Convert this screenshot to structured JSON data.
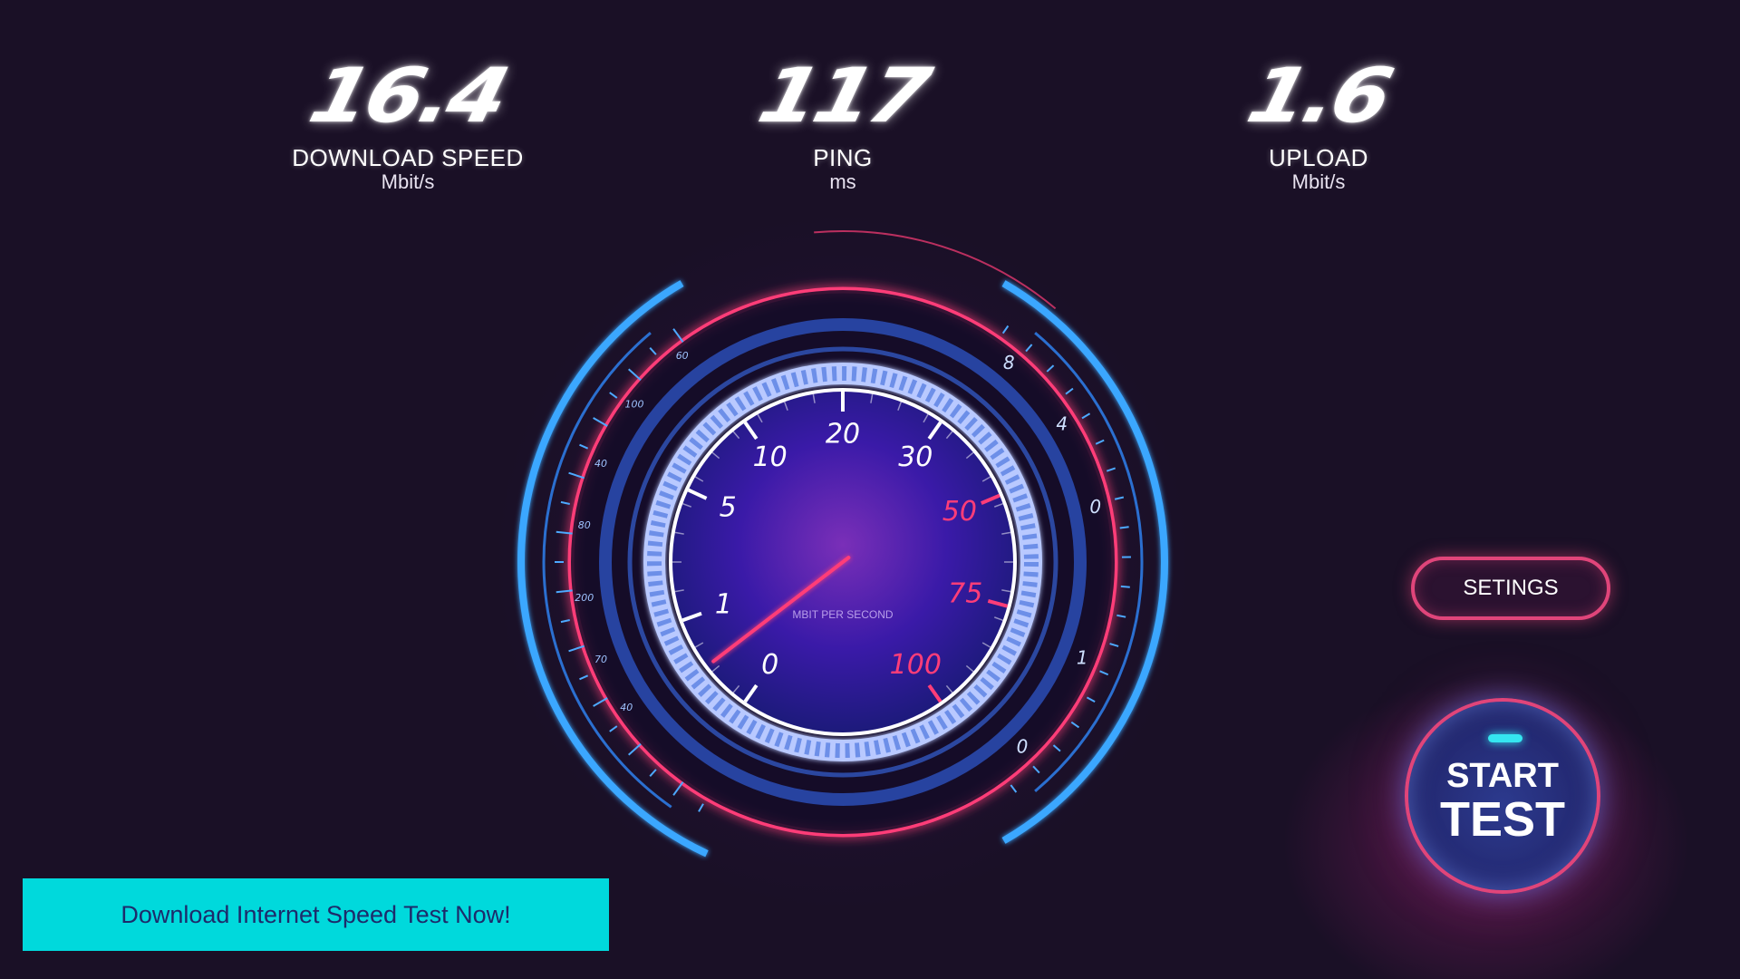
{
  "stats": {
    "download": {
      "value": "16.4",
      "label": "DOWNLOAD SPEED",
      "unit": "Mbit/s"
    },
    "ping": {
      "value": "117",
      "label": "PING",
      "unit": "ms"
    },
    "upload": {
      "value": "1.6",
      "label": "UPLOAD",
      "unit": "Mbit/s"
    }
  },
  "gauge": {
    "scale_labels": [
      "0",
      "1",
      "5",
      "10",
      "20",
      "30",
      "50",
      "75",
      "100"
    ],
    "center_label": "MBIT PER SECOND",
    "needle_reading": 0.5,
    "left_arc_labels": [
      "60",
      "100",
      "40",
      "80",
      "200",
      "70",
      "40"
    ],
    "right_arc_labels": [
      "8",
      "4",
      "0",
      "1",
      "0"
    ],
    "colors": {
      "accent_pink": "#ff3d78",
      "accent_blue": "#3aa7ff",
      "dial_center": "#3a1aa8"
    }
  },
  "controls": {
    "settings_label": "SETINGS",
    "start_line1": "START",
    "start_line2": "TEST"
  },
  "banner": {
    "label": "Download Internet Speed Test Now!"
  },
  "colors": {
    "background": "#1a1026",
    "banner_bg": "#00d9dc",
    "banner_text": "#1d2b6b"
  }
}
